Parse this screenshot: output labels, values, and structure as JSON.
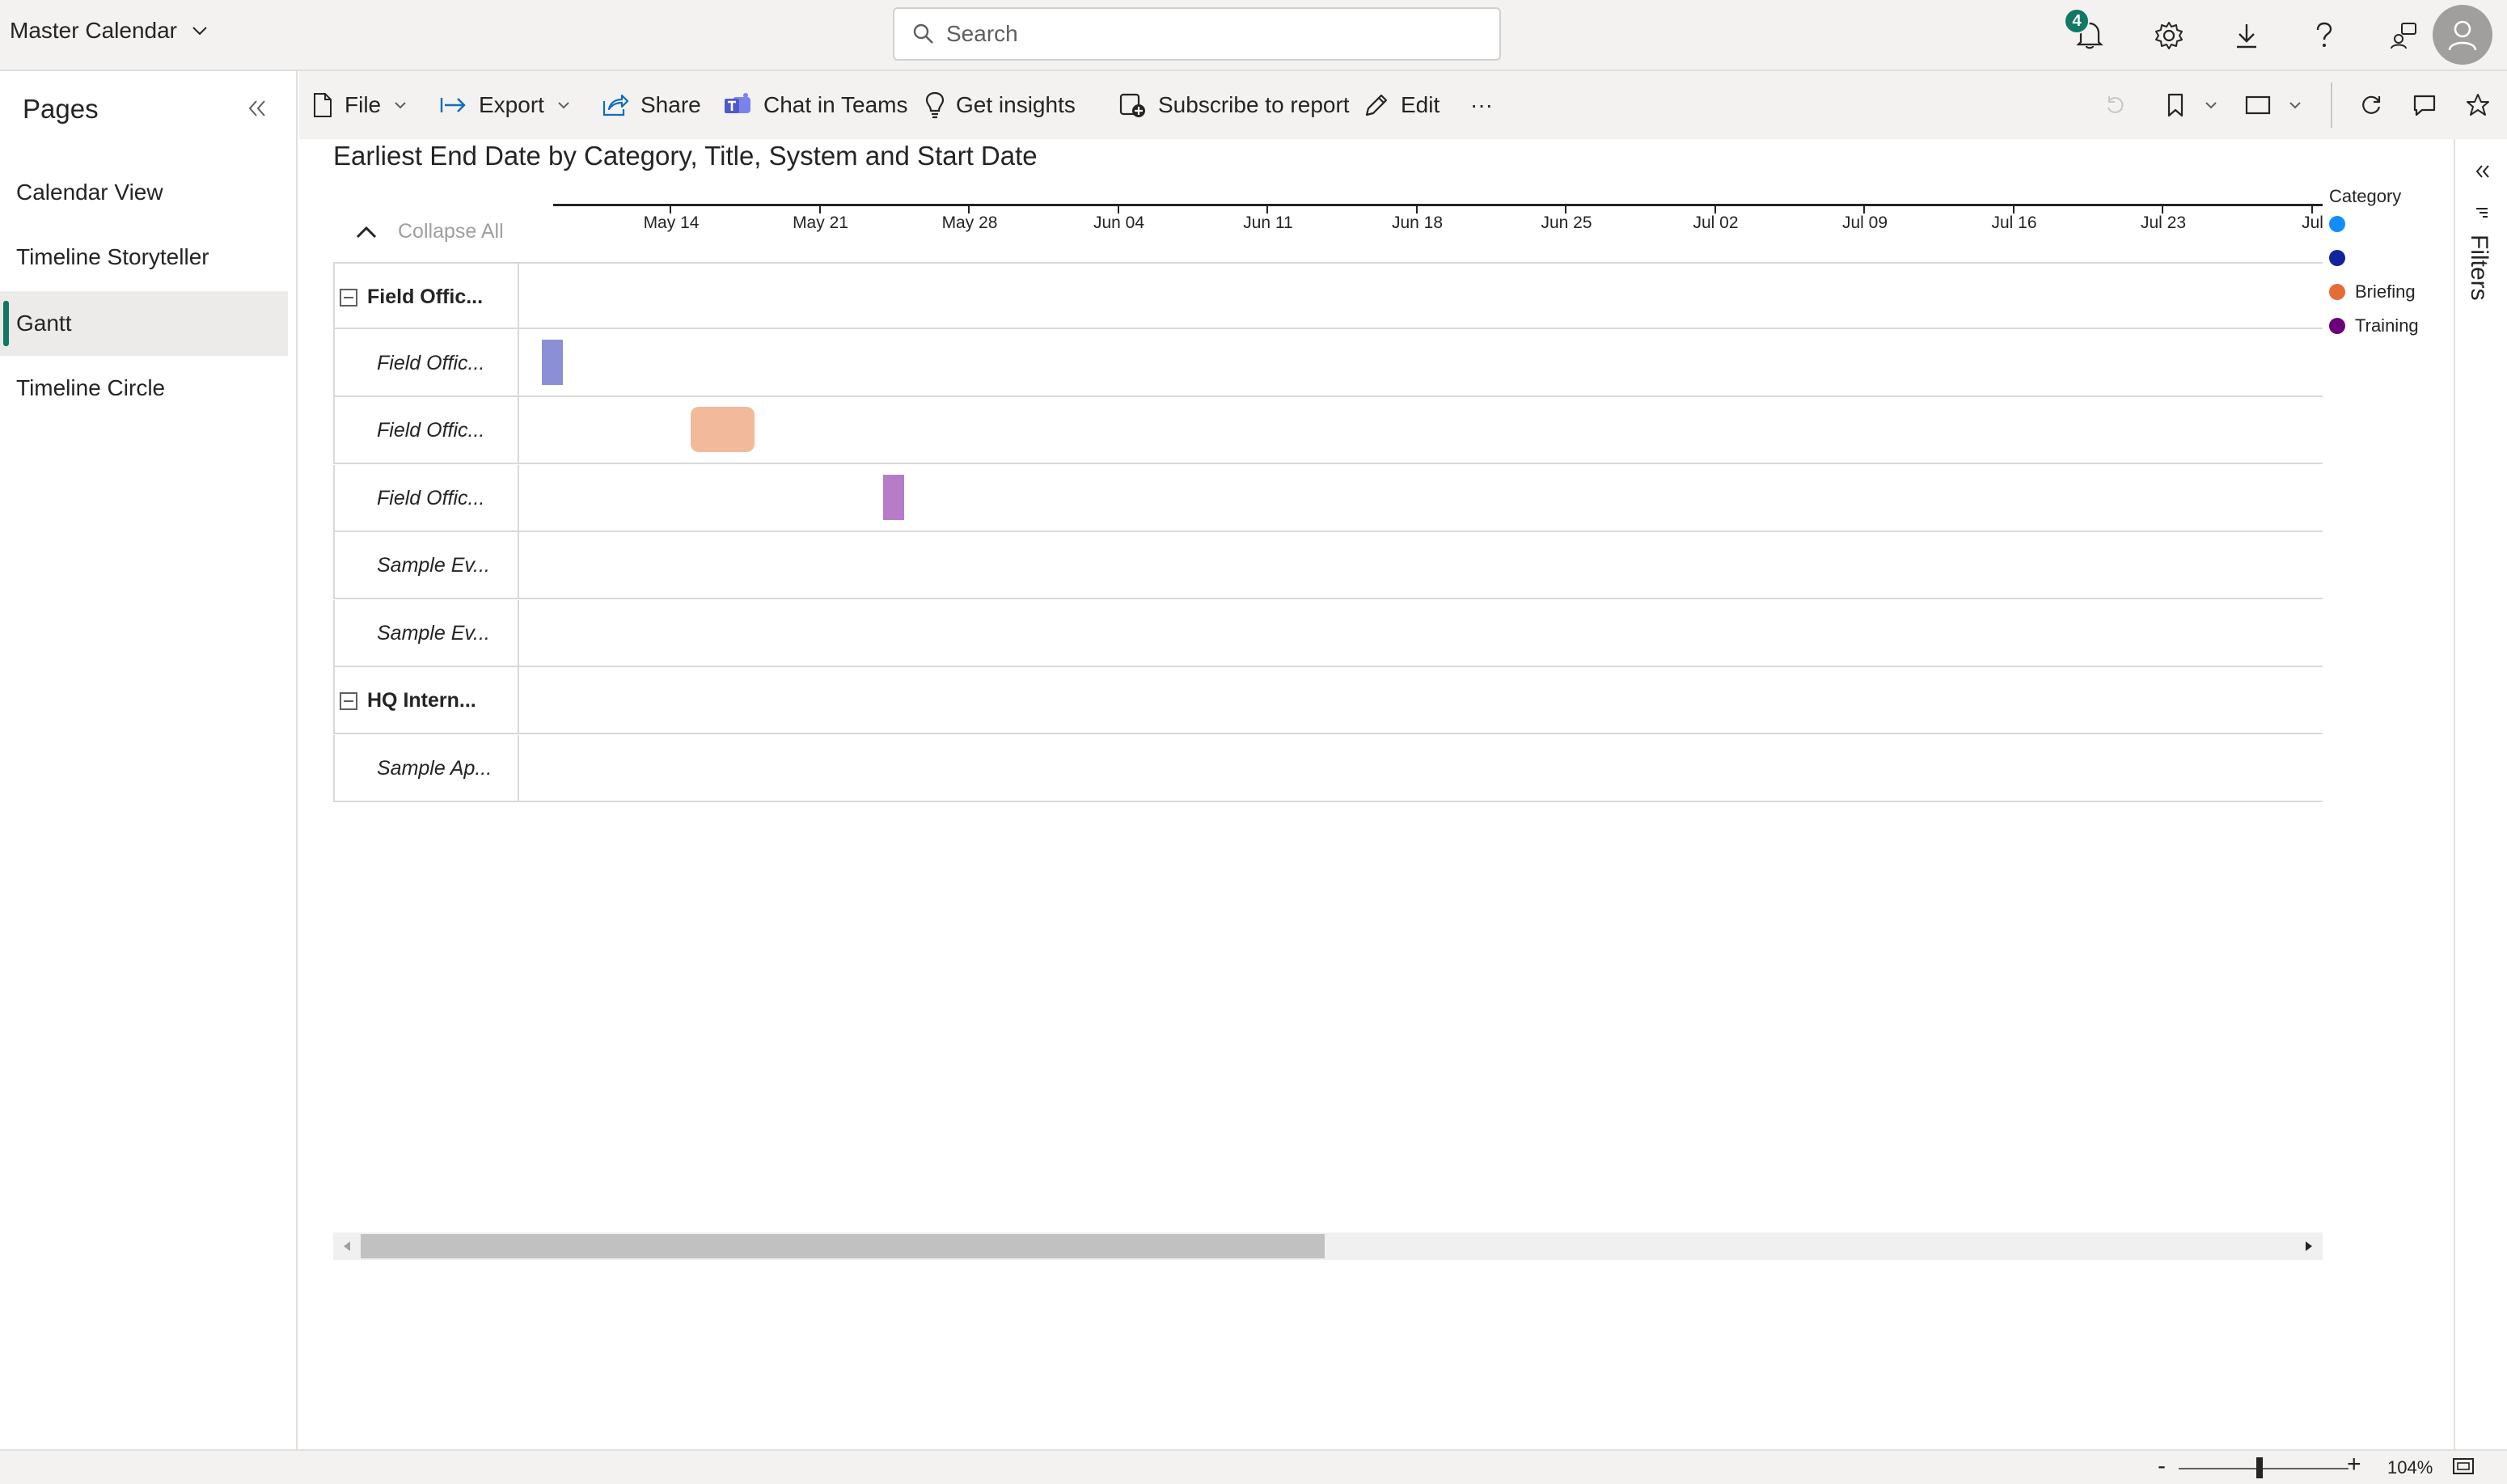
{
  "app": {
    "title": "Master Calendar"
  },
  "search": {
    "placeholder": "Search"
  },
  "notifications": {
    "count": "4"
  },
  "pages": {
    "title": "Pages",
    "items": [
      {
        "label": "Calendar View",
        "active": false
      },
      {
        "label": "Timeline Storyteller",
        "active": false
      },
      {
        "label": "Gantt",
        "active": true
      },
      {
        "label": "Timeline Circle",
        "active": false
      }
    ]
  },
  "toolbar": {
    "file": "File",
    "export": "Export",
    "share": "Share",
    "chat": "Chat in Teams",
    "insights": "Get insights",
    "subscribe": "Subscribe to report",
    "edit": "Edit",
    "more": "···"
  },
  "visual": {
    "title": "Earliest End Date by Category, Title, System and Start Date",
    "collapse_all": "Collapse All"
  },
  "chart_data": {
    "type": "gantt",
    "x_axis": {
      "ticks": [
        "May 14",
        "May 21",
        "May 28",
        "Jun 04",
        "Jun 11",
        "Jun 18",
        "Jun 25",
        "Jul 02",
        "Jul 09",
        "Jul 16",
        "Jul 23",
        "Jul"
      ]
    },
    "rows": [
      {
        "label": "Field Offic...",
        "level": "group"
      },
      {
        "label": "Field Offic...",
        "level": "child",
        "bar": {
          "start": "May 08",
          "end": "May 09",
          "category_color": "#8a8fd6"
        }
      },
      {
        "label": "Field Offic...",
        "level": "child",
        "bar": {
          "start": "May 15",
          "end": "May 18",
          "category": "Briefing"
        }
      },
      {
        "label": "Field Offic...",
        "level": "child",
        "bar": {
          "start": "May 24",
          "end": "May 25",
          "category": "Training"
        }
      },
      {
        "label": "Sample Ev...",
        "level": "child"
      },
      {
        "label": "Sample Ev...",
        "level": "child"
      },
      {
        "label": "HQ Intern...",
        "level": "group"
      },
      {
        "label": "Sample Ap...",
        "level": "child"
      }
    ],
    "legend": {
      "title": "Category",
      "items": [
        {
          "label": "",
          "color": "#118dff"
        },
        {
          "label": "",
          "color": "#12239e"
        },
        {
          "label": "Briefing",
          "color": "#e66c37"
        },
        {
          "label": "Training",
          "color": "#6b007b"
        }
      ]
    },
    "bar_colors": {
      "Briefing": "#f2b99b",
      "Training": "#b77cc8"
    }
  },
  "filters": {
    "label": "Filters"
  },
  "status": {
    "zoom": "104%",
    "zoom_minus": "-",
    "zoom_plus": "+"
  }
}
